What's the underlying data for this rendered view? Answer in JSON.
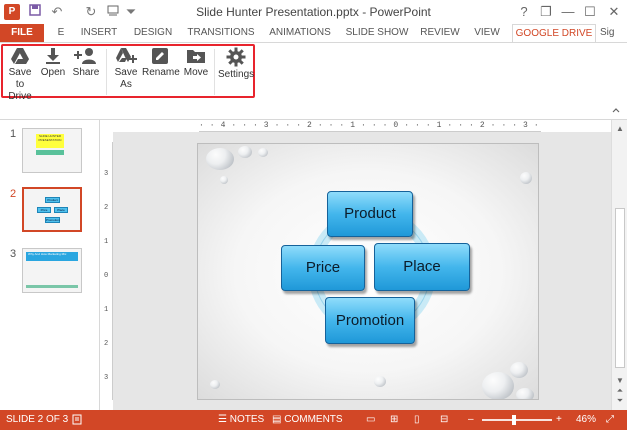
{
  "window": {
    "title": "Slide Hunter  Presentation.pptx - PowerPoint",
    "app_icon": "P",
    "controls": [
      "?",
      "❐",
      "—",
      "☐",
      "✕"
    ]
  },
  "quick_access": {
    "icons": [
      "save-icon",
      "undo-icon",
      "redo-icon",
      "customize-icon"
    ]
  },
  "tabs": {
    "file": "FILE",
    "partial": "E",
    "items": [
      "INSERT",
      "DESIGN",
      "TRANSITIONS",
      "ANIMATIONS",
      "SLIDE SHOW",
      "REVIEW",
      "VIEW"
    ],
    "active": "GOOGLE DRIVE",
    "signin": "Sig"
  },
  "ribbon": {
    "buttons": [
      {
        "label": "Save to Drive",
        "icon": "drive-icon"
      },
      {
        "label": "Open",
        "icon": "download-icon"
      },
      {
        "label": "Share",
        "icon": "add-person-icon"
      },
      {
        "label": "Save As",
        "icon": "drive-add-icon"
      },
      {
        "label": "Rename",
        "icon": "pencil-icon"
      },
      {
        "label": "Move",
        "icon": "folder-arrow-icon"
      },
      {
        "label": "Settings",
        "icon": "gear-icon"
      }
    ],
    "accent": "#e8242d"
  },
  "thumbnails": [
    {
      "number": "1",
      "text": "SLIDE HUNTER PRESENTATION"
    },
    {
      "number": "2",
      "labels": [
        "Product",
        "Price",
        "Place",
        "Promotion"
      ]
    },
    {
      "number": "3",
      "text": "Why And How Marketing Mix"
    }
  ],
  "ruler": {
    "horizontal": "· · 4 · · · 3 · · · 2 · · · 1 · · · 0 · · · 1 · · · 2 · · · 3 · · · 4 · ·",
    "vertical": [
      "3",
      "2",
      "1",
      "0",
      "1",
      "2",
      "3"
    ]
  },
  "slide": {
    "shapes": [
      "Product",
      "Price",
      "Place",
      "Promotion"
    ]
  },
  "status": {
    "slide_info": "SLIDE 2 OF 3",
    "notes": "NOTES",
    "comments": "COMMENTS",
    "zoom": "46%",
    "minus": "–",
    "plus": "+"
  },
  "colors": {
    "brand": "#d24726",
    "shape_fill": "#43b6ec"
  }
}
